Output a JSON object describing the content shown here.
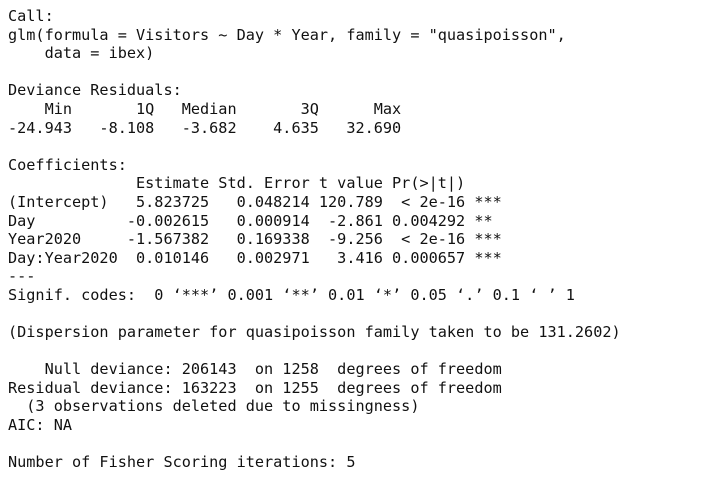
{
  "console": {
    "lines": [
      "Call:",
      "glm(formula = Visitors ~ Day * Year, family = \"quasipoisson\",",
      "    data = ibex)",
      "",
      "Deviance Residuals:",
      "    Min       1Q   Median       3Q      Max",
      "-24.943   -8.108   -3.682    4.635   32.690",
      "",
      "Coefficients:",
      "              Estimate Std. Error t value Pr(>|t|)",
      "(Intercept)   5.823725   0.048214 120.789  < 2e-16 ***",
      "Day          -0.002615   0.000914  -2.861 0.004292 **",
      "Year2020     -1.567382   0.169338  -9.256  < 2e-16 ***",
      "Day:Year2020  0.010146   0.002971   3.416 0.000657 ***",
      "---",
      "Signif. codes:  0 ‘***’ 0.001 ‘**’ 0.01 ‘*’ 0.05 ‘.’ 0.1 ‘ ’ 1",
      "",
      "(Dispersion parameter for quasipoisson family taken to be 131.2602)",
      "",
      "    Null deviance: 206143  on 1258  degrees of freedom",
      "Residual deviance: 163223  on 1255  degrees of freedom",
      "  (3 observations deleted due to missingness)",
      "AIC: NA",
      "",
      "Number of Fisher Scoring iterations: 5"
    ]
  }
}
